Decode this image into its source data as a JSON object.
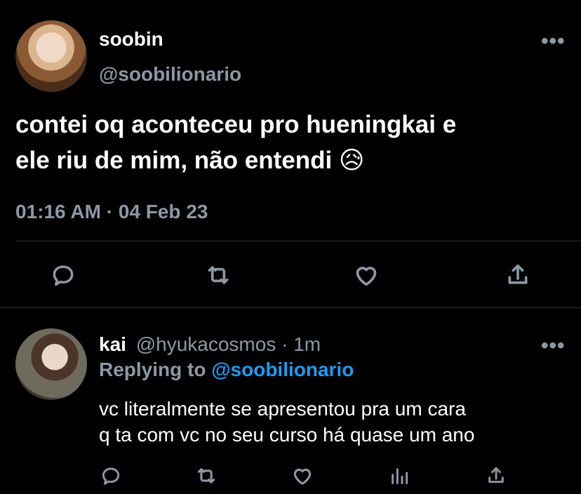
{
  "tweet": {
    "author_name": "soobin",
    "author_handle": "@soobilionario",
    "text": "contei oq aconteceu pro hueningkai e\nele riu de mim, não entendi 😥",
    "timestamp": "01:16 AM · 04 Feb 23",
    "more_label": "•••"
  },
  "reply": {
    "author_name": "kai",
    "author_handle": "@hyukacosmos",
    "separator": "·",
    "time_ago": "1m",
    "replying_prefix": "Replying to",
    "replying_handle": "@soobilionario",
    "text": "vc literalmente se apresentou pra um cara\nq ta com vc no seu curso há quase um ano",
    "more_label": "•••"
  },
  "colors": {
    "background": "#000000",
    "text": "#ffffff",
    "muted": "#8b98a5",
    "link": "#1d9bf0",
    "divider": "#2f3336"
  },
  "icons": {
    "main_actions": [
      "reply-icon",
      "retweet-icon",
      "like-icon",
      "share-icon"
    ],
    "reply_actions": [
      "reply-icon",
      "retweet-icon",
      "like-icon",
      "analytics-icon",
      "share-icon"
    ]
  }
}
